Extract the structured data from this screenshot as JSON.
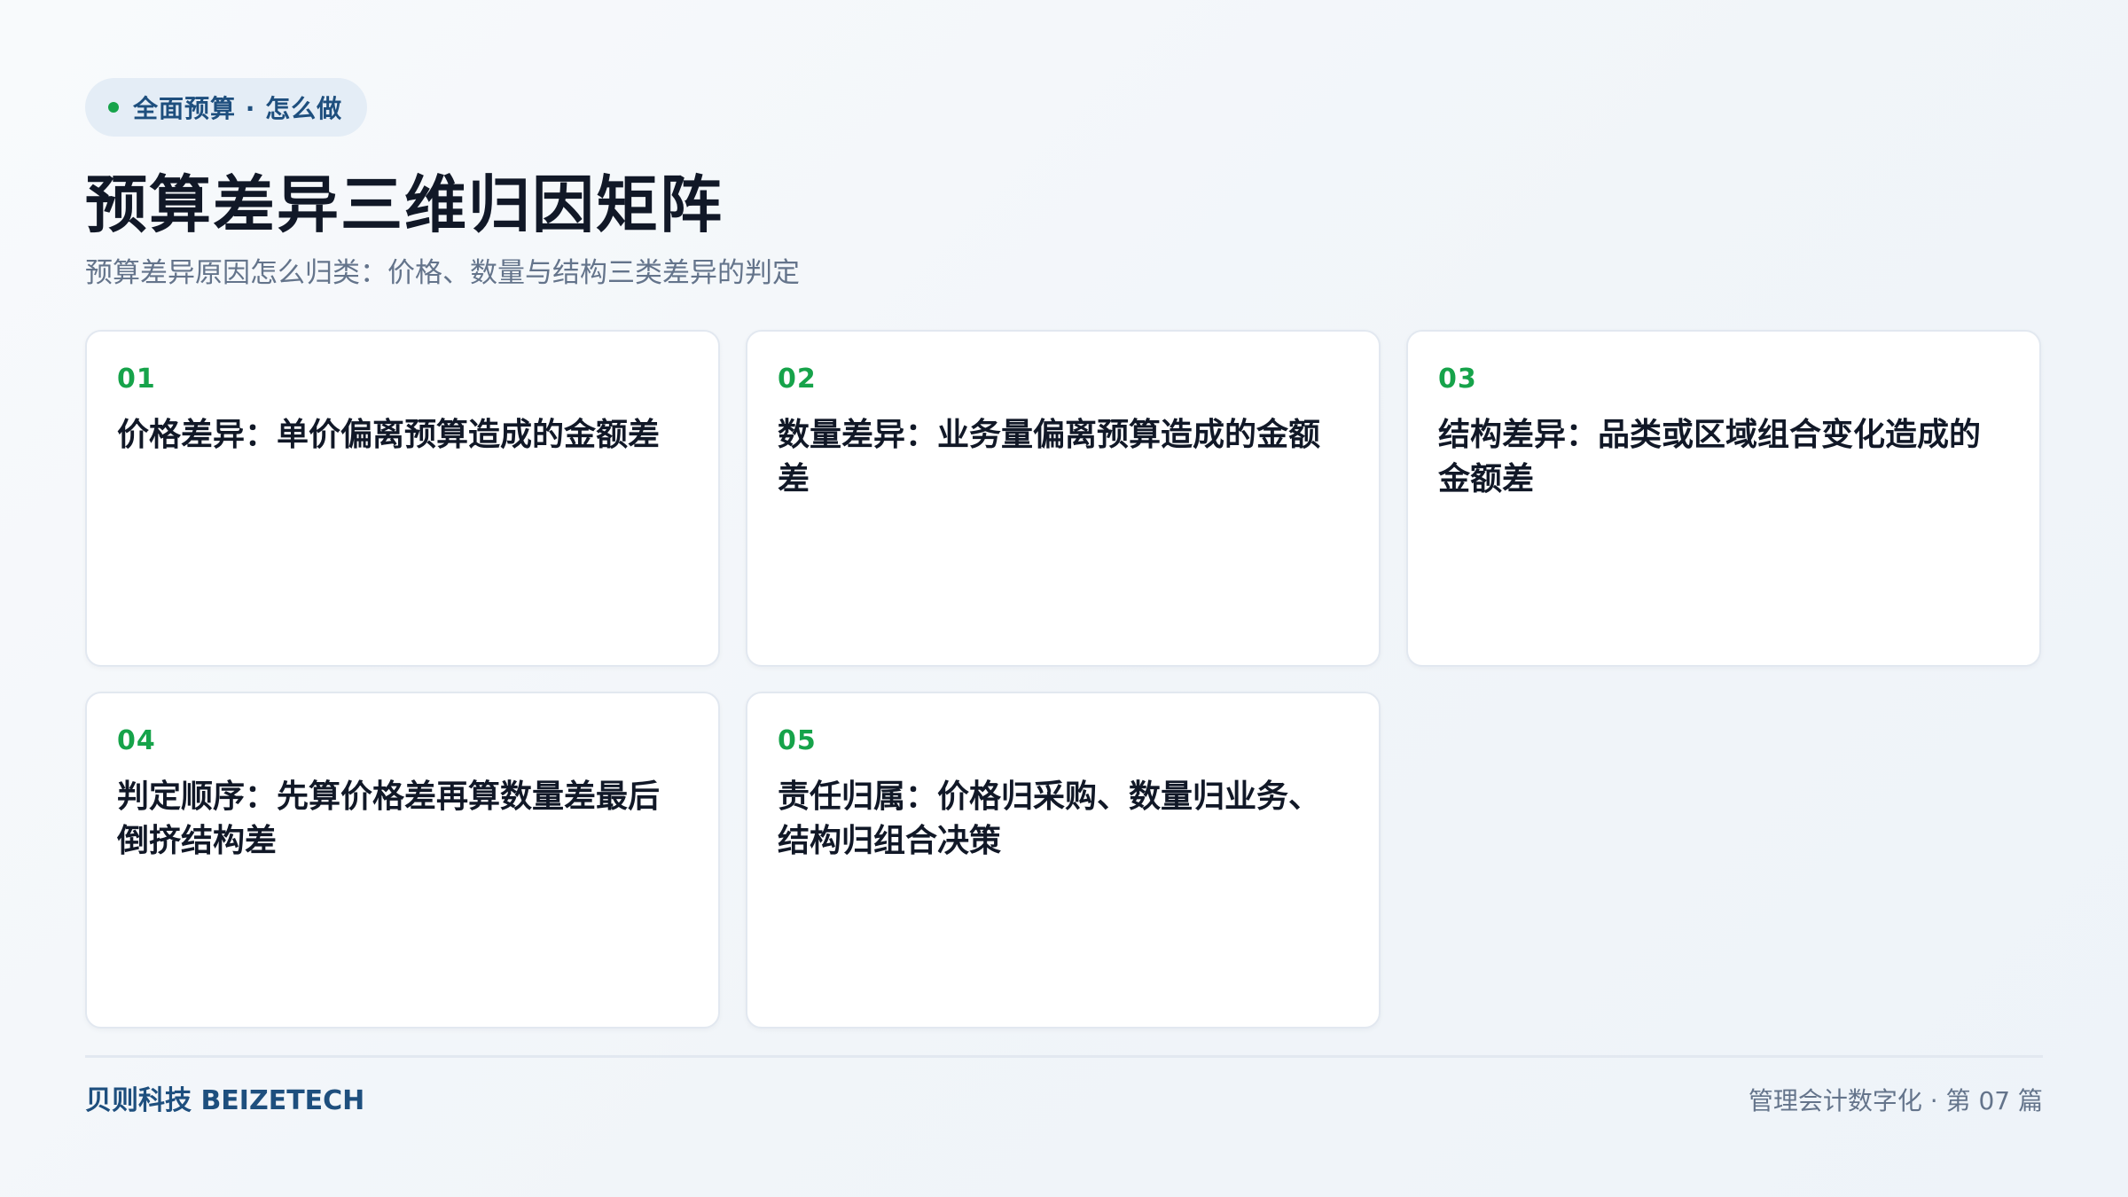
{
  "tag": {
    "label": "全面预算 · 怎么做",
    "dot_color": "#16a34a"
  },
  "title": "预算差异三维归因矩阵",
  "subtitle": "预算差异原因怎么归类：价格、数量与结构三类差异的判定",
  "cards": [
    {
      "num": "01",
      "text": "价格差异：单价偏离预算造成的金额差"
    },
    {
      "num": "02",
      "text": "数量差异：业务量偏离预算造成的金额差"
    },
    {
      "num": "03",
      "text": "结构差异：品类或区域组合变化造成的金额差"
    },
    {
      "num": "04",
      "text": "判定顺序：先算价格差再算数量差最后倒挤结构差"
    },
    {
      "num": "05",
      "text": "责任归属：价格归采购、数量归业务、结构归组合决策"
    }
  ],
  "footer": {
    "brand": "贝则科技 BEIZETECH",
    "series": "管理会计数字化 · 第 07 篇"
  },
  "colors": {
    "accent": "#16a34a",
    "brand": "#1e4f7e"
  }
}
